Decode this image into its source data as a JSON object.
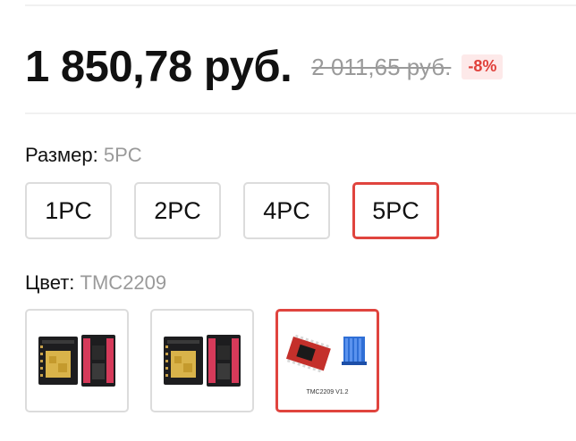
{
  "price": {
    "current": "1 850,78 руб.",
    "old": "2 011,65 руб.",
    "discount": "-8%"
  },
  "size_option": {
    "label": "Размер:",
    "selected_value": "5PC",
    "options": [
      "1PC",
      "2PC",
      "4PC",
      "5PC"
    ],
    "selected_index": 3
  },
  "color_option": {
    "label": "Цвет:",
    "selected_value": "TMC2209",
    "thumbnails": [
      {
        "kind": "driver-board-pair"
      },
      {
        "kind": "driver-board-pair"
      },
      {
        "kind": "driver-with-heatsink",
        "caption": "TMC2209 V1.2"
      }
    ],
    "selected_index": 2
  },
  "colors": {
    "accent": "#e0443e",
    "muted_text": "#9a9a9a",
    "badge_bg": "#fde9e9",
    "badge_text": "#e0403a"
  }
}
